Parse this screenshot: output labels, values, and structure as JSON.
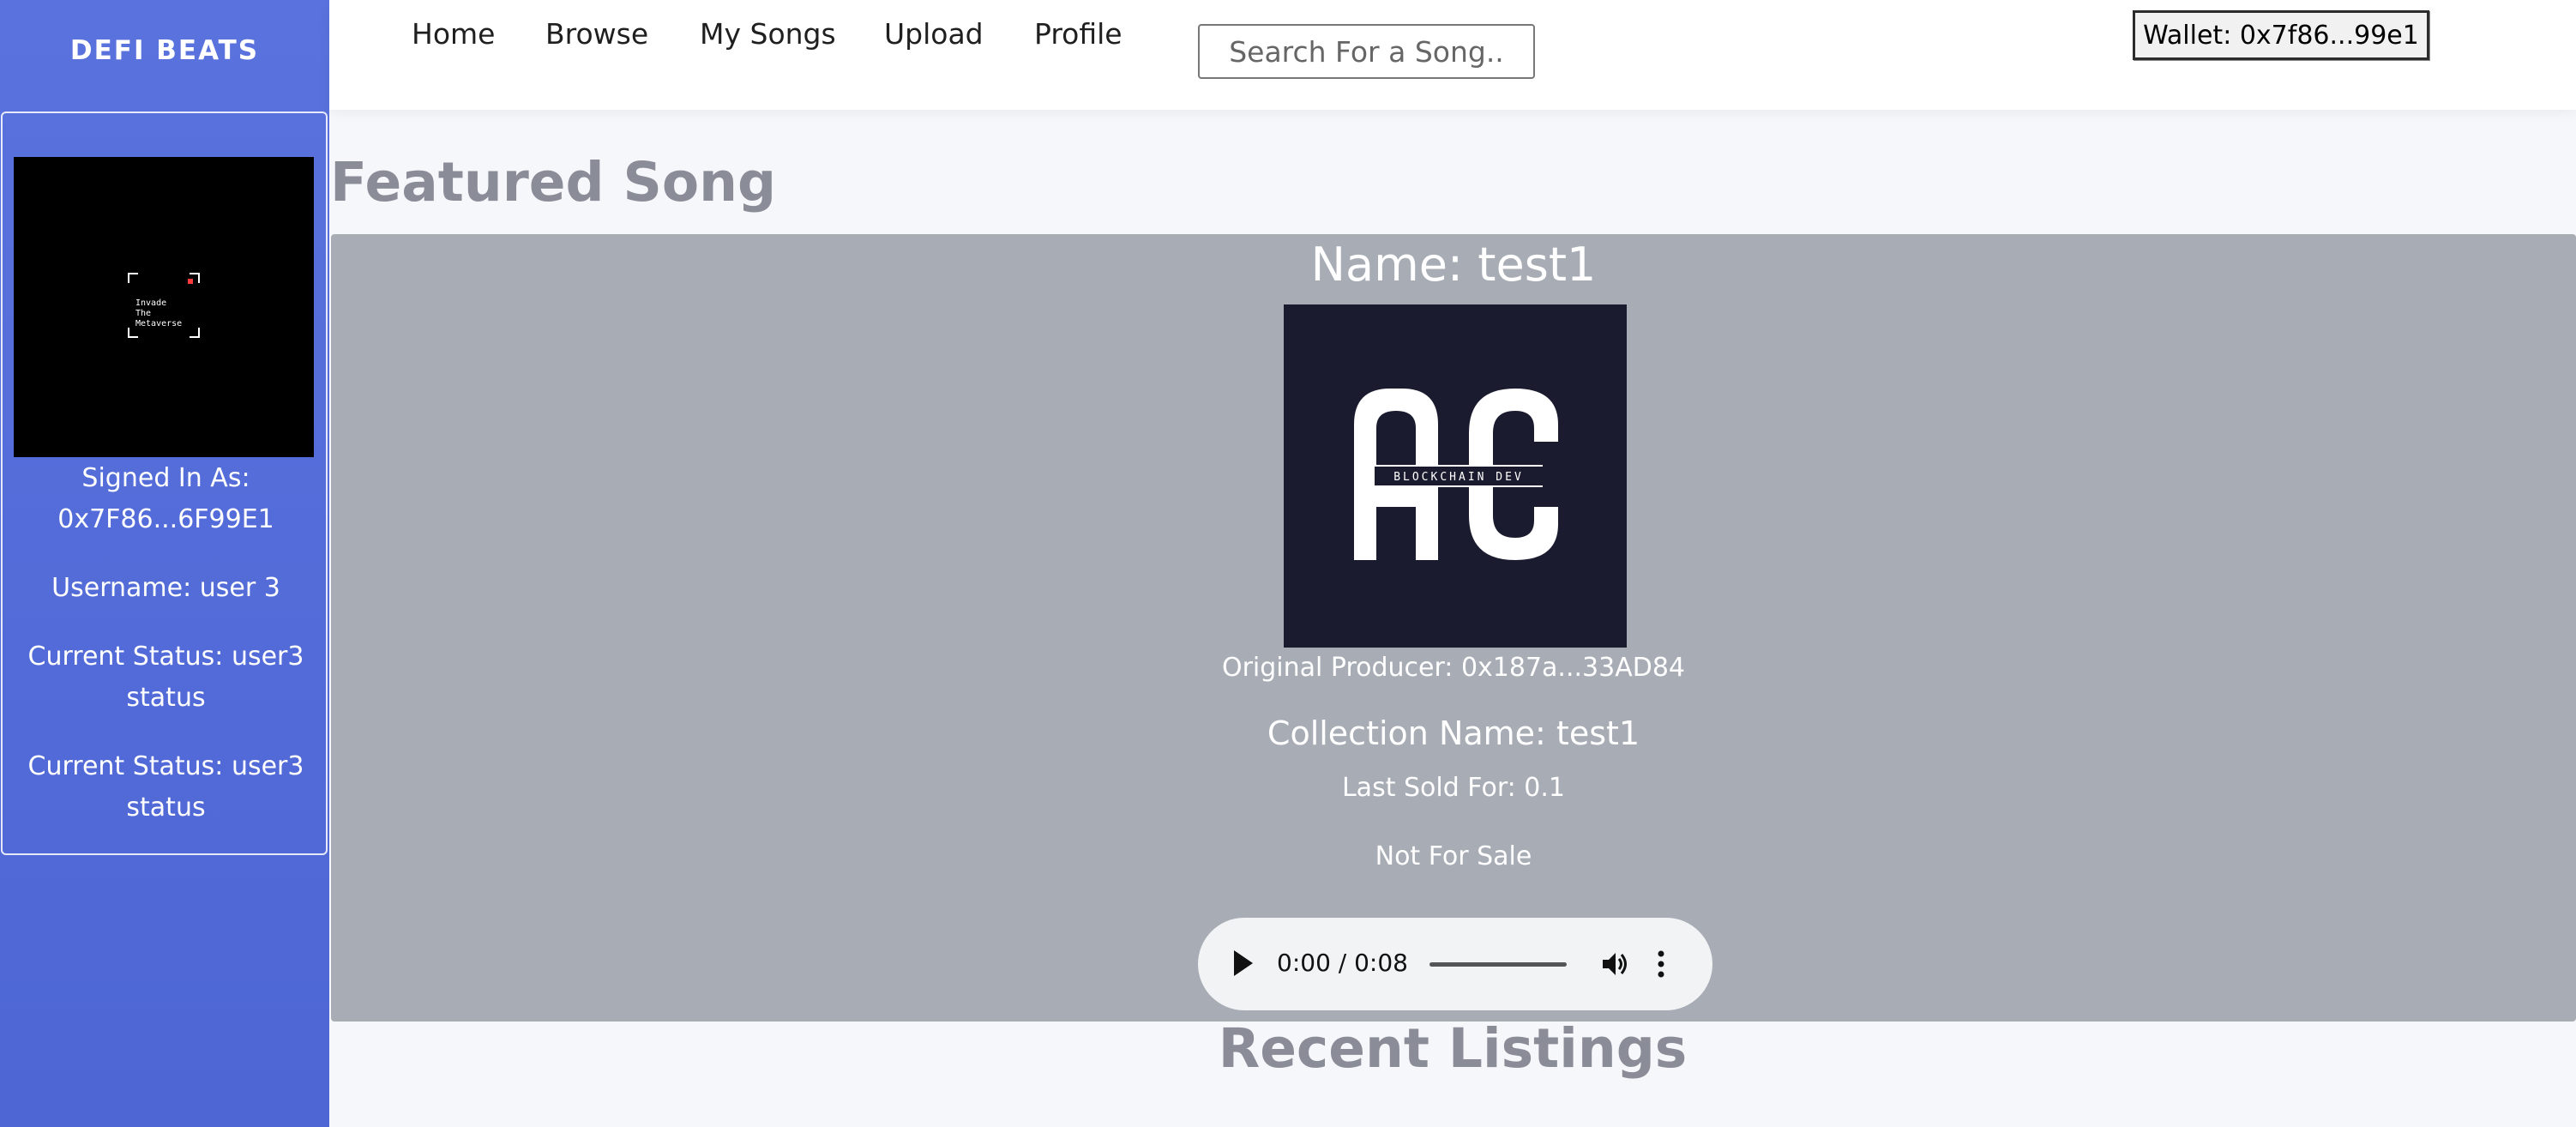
{
  "sidebar": {
    "brand": "DEFI BEATS",
    "avatar_text": "Invade\nThe\nMetaverse",
    "signed_in_label": "Signed In As:",
    "signed_in_address": "0x7F86...6F99E1",
    "username": "Username: user 3",
    "status_1_line1": "Current Status: user3",
    "status_1_line2": "status",
    "status_2_line1": "Current Status: user3",
    "status_2_line2": "status"
  },
  "nav": {
    "items": [
      "Home",
      "Browse",
      "My Songs",
      "Upload",
      "Profile"
    ],
    "search_placeholder": "Search For a Song..",
    "wallet": "Wallet: 0x7f86...99e1"
  },
  "featured": {
    "section_title": "Featured Song",
    "name": "Name: test1",
    "cover_logo_text": "BLOCKCHAIN DEV",
    "producer": "Original Producer: 0x187a...33AD84",
    "collection": "Collection Name: test1",
    "last_sold": "Last Sold For: 0.1",
    "sale_status": "Not For Sale",
    "audio": {
      "time": "0:00 / 0:08"
    }
  },
  "recent": {
    "title": "Recent Listings"
  },
  "colors": {
    "sidebar": "#5a72dd",
    "card": "#a8adb5",
    "page": "#f6f7fb"
  }
}
